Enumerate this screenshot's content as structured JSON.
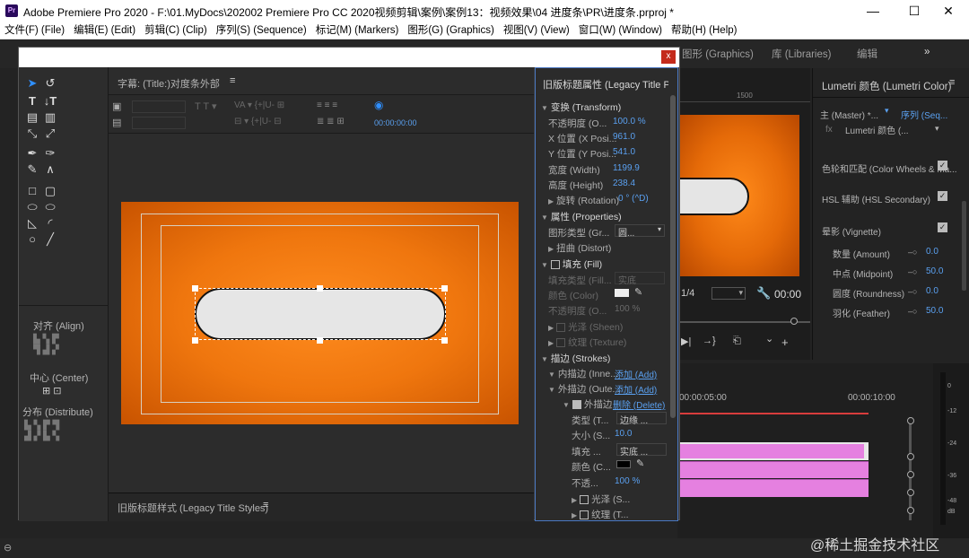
{
  "window": {
    "title": "Adobe Premiere Pro 2020 - F:\\01.MyDocs\\202002 Premiere Pro CC 2020视频剪辑\\案例\\案例13：视频效果\\04 进度条\\PR\\进度条.prproj *",
    "logo": "Pr",
    "minimize": "—",
    "maximize": "☐",
    "close": "✕"
  },
  "menu": [
    "文件(F) (File)",
    "编辑(E) (Edit)",
    "剪辑(C) (Clip)",
    "序列(S) (Sequence)",
    "标记(M) (Markers)",
    "图形(G) (Graphics)",
    "视图(V) (View)",
    "窗口(W) (Window)",
    "帮助(H) (Help)"
  ],
  "workspace": {
    "graphics": "图形 (Graphics)",
    "libraries": "库 (Libraries)",
    "editing": "编辑",
    "more": "»"
  },
  "dialog": {
    "close": "x",
    "canvas_title": "字幕: (Title:)对度条外部",
    "timecode": "00:00:00:00",
    "align": "对齐 (Align)",
    "center": "中心 (Center)",
    "distribute": "分布 (Distribute)",
    "styles": "旧版标题样式 (Legacy Title Styles)",
    "props_title": "旧版标题属性 (Legacy Title Pr",
    "transform": "变换 (Transform)",
    "opacity_l": "不透明度 (O...",
    "opacity_v": "100.0 %",
    "x_l": "X 位置 (X Posi...",
    "x_v": "961.0",
    "y_l": "Y 位置 (Y Posi...",
    "y_v": "541.0",
    "w_l": "宽度 (Width)",
    "w_v": "1199.9",
    "h_l": "高度 (Height)",
    "h_v": "238.4",
    "rot_l": "旋转 (Rotation)",
    "rot_v": "0 ° (^D)",
    "properties": "属性 (Properties)",
    "gtype_l": "图形类型 (Gr...",
    "gtype_v": "圆...",
    "distort": "扭曲 (Distort)",
    "fill": "填充 (Fill)",
    "ftype_l": "填充类型 (Fill...",
    "ftype_v": "实底",
    "fcolor_l": "颜色 (Color)",
    "fop_l": "不透明度 (O...",
    "fop_v": "100 %",
    "sheen": "光泽 (Sheen)",
    "texture": "纹理 (Texture)",
    "strokes": "描边 (Strokes)",
    "inner_l": "内描边 (Inne...",
    "inner_v": "添加 (Add)",
    "outer_l": "外描边 (Oute...",
    "outer_v": "添加 (Add)",
    "outer2_l": "外描边",
    "outer2_v": "删除 (Delete)",
    "stype_l": "类型 (T...",
    "stype_v": "边缘 ...",
    "ssize_l": "大小 (S...",
    "ssize_v": "10.0",
    "sfill_l": "填充 ...",
    "sfill_v": "实底 ...",
    "scolor_l": "颜色 (C...",
    "sop_l": "不透...",
    "sop_v": "100 %",
    "ssheen": "光泽 (S...",
    "stexture": "纹理 (T..."
  },
  "program": {
    "page": "1/4",
    "tc": "00:00",
    "ruler": "1500"
  },
  "lumetri": {
    "title": "Lumetri 颜色 (Lumetri Color)",
    "master": "主 (Master) *...",
    "sequence": "序列 (Seq...",
    "fx": "fx",
    "effect": "Lumetri 颜色 (...",
    "wheels": "色轮和匹配 (Color Wheels & Ma...",
    "hsl": "HSL 辅助 (HSL Secondary)",
    "vignette": "晕影 (Vignette)",
    "rows": [
      {
        "label": "数量 (Amount)",
        "value": "0.0"
      },
      {
        "label": "中点 (Midpoint)",
        "value": "50.0"
      },
      {
        "label": "圆度 (Roundness)",
        "value": "0.0"
      },
      {
        "label": "羽化 (Feather)",
        "value": "50.0"
      }
    ]
  },
  "timeline": {
    "t1": "00:00:05:00",
    "t2": "00:00:10:00"
  },
  "meter": {
    "ticks": [
      "0",
      "-12",
      "-24",
      "-36",
      "-48",
      "dB"
    ]
  },
  "watermark": "@稀土掘金技术社区",
  "colors": {
    "accent": "#4a78c2",
    "orange": "#e8720c",
    "pink": "#e580e0",
    "blue": "#5aa0f0"
  }
}
